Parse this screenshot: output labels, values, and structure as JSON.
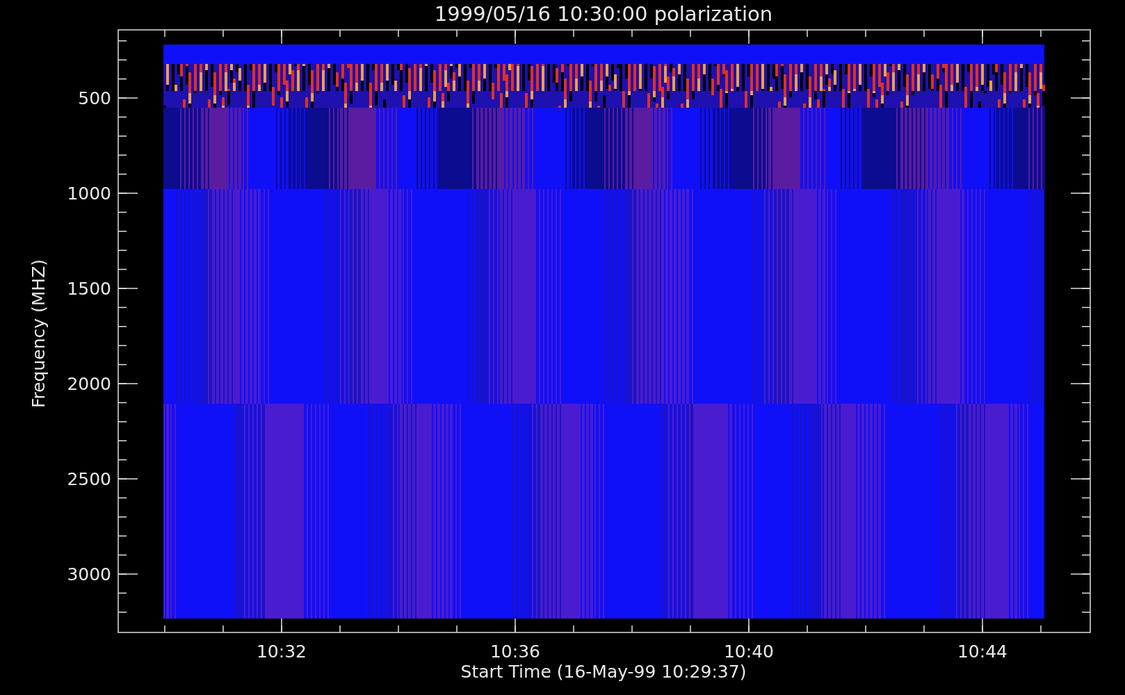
{
  "title": "1999/05/16 10:30:00 polarization",
  "xlabel": "Start Time (16-May-99 10:29:37)",
  "ylabel": "Frequency (MHZ)",
  "xticks": [
    "10:32",
    "10:36",
    "10:40",
    "10:44"
  ],
  "yticks": [
    "500",
    "1000",
    "1500",
    "2000",
    "2500",
    "3000"
  ]
}
